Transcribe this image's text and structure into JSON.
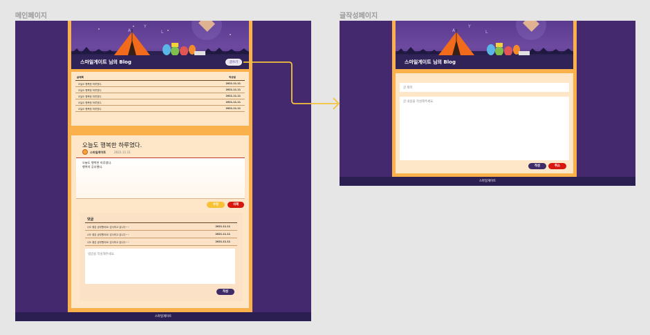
{
  "frames": {
    "main_title": "메인페이지",
    "write_title": "글작성페이지"
  },
  "blog": {
    "title": "스마일게이트 님의 Blog",
    "write_button": "글쓰기"
  },
  "post_table": {
    "headers": {
      "title": "글제목",
      "date": "작성일"
    },
    "rows": [
      {
        "title": "오늘도 행복한 하루였다.",
        "date": "2021.11.11"
      },
      {
        "title": "오늘도 행복한 하루였다.",
        "date": "2021.11.11"
      },
      {
        "title": "오늘도 행복한 하루였다.",
        "date": "2021.11.11"
      },
      {
        "title": "오늘도 행복한 하루였다.",
        "date": "2021.11.11"
      },
      {
        "title": "오늘도 행복한 하루였다.",
        "date": "2021.11.11"
      }
    ]
  },
  "post": {
    "title": "오늘도 행복한 하루였다.",
    "author": "스마일게이트",
    "date": "2021.11.11",
    "body_line1": "오늘도 행복한 하루였다.",
    "body_line2": "행복의 공부했다.",
    "edit_button": "수정",
    "delete_button": "삭제"
  },
  "comments": {
    "title": "댓글",
    "rows": [
      {
        "text": "나도 좋은 공부했어요! 감사하고 갑니다~~",
        "date": "2021.11.11"
      },
      {
        "text": "나도 좋은 공부했어요! 감사하고 갑니다~~",
        "date": "2021.11.11"
      },
      {
        "text": "나도 좋은 공부했어요! 감사하고 갑니다~~",
        "date": "2021.11.11"
      }
    ],
    "placeholder": "댓글을 작성해주세요.",
    "submit_button": "작성"
  },
  "footer": {
    "text": "스마일게이트"
  },
  "write_page": {
    "title_placeholder": "글 제목",
    "body_placeholder": "글 내용을 작성해주세요.",
    "submit_button": "작성",
    "cancel_button": "취소"
  },
  "colors": {
    "background": "#e6e6e6",
    "frame_purple": "#44296e",
    "orange": "#fbb14b",
    "panel": "#fde7c8",
    "header_bar": "#2f2358",
    "red": "#d8180f",
    "yellow": "#f7c235",
    "arrow": "#f5c33b"
  }
}
